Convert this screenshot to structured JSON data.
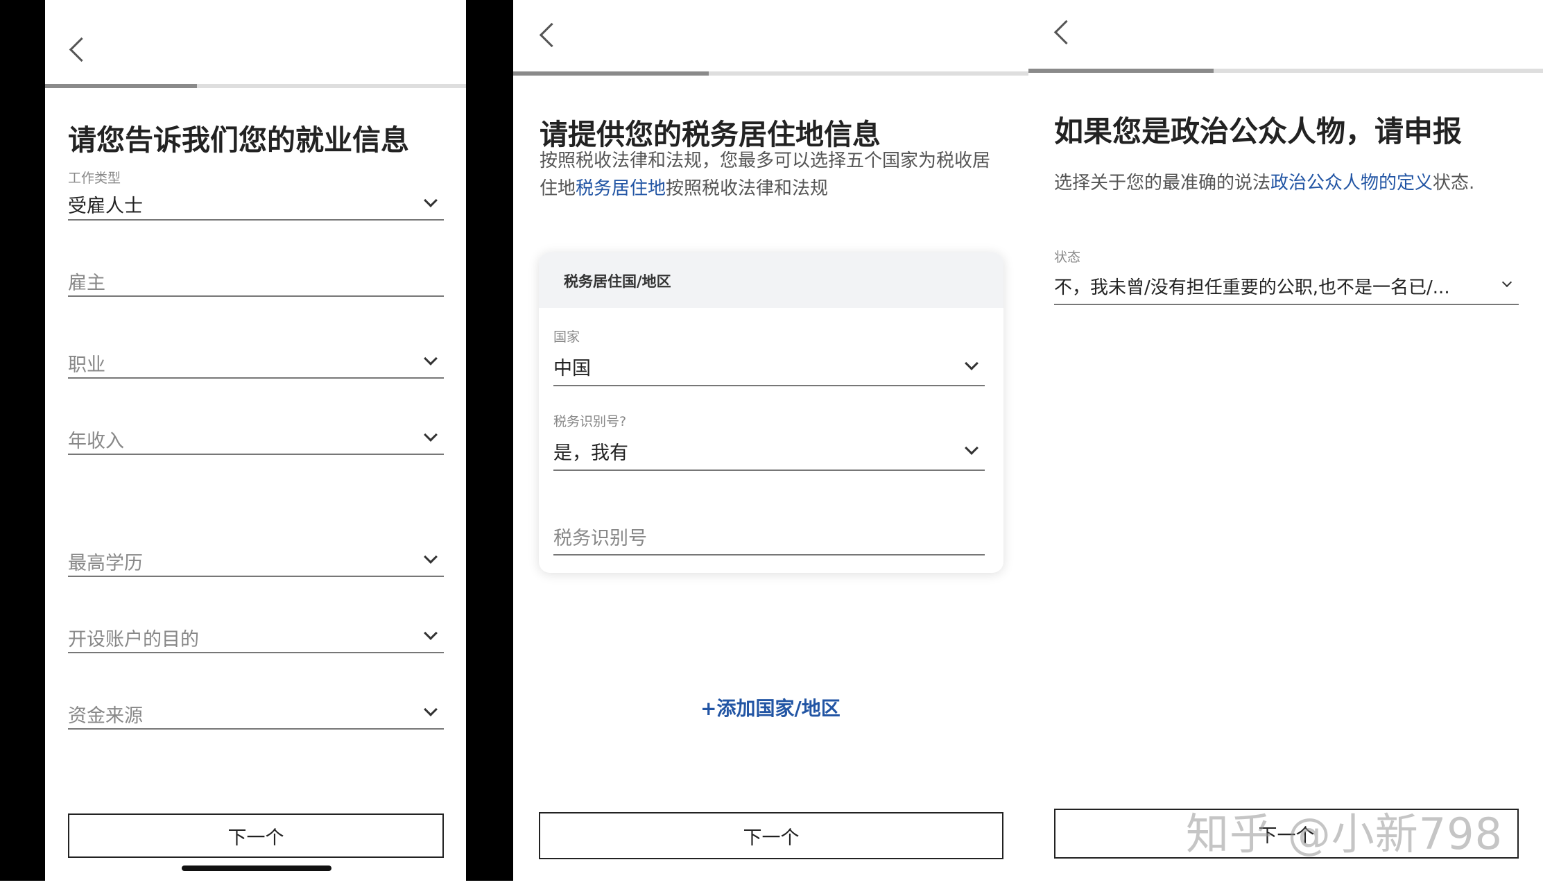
{
  "screen1": {
    "title": "请您告诉我们您的就业信息",
    "fields": [
      {
        "label": "工作类型",
        "value": "受雇人士"
      },
      {
        "placeholder": "雇主"
      },
      {
        "placeholder": "职业"
      },
      {
        "placeholder": "年收入"
      },
      {
        "placeholder": "最高学历"
      },
      {
        "placeholder": "开设账户的目的"
      },
      {
        "placeholder": "资金来源"
      }
    ],
    "next_label": "下一个",
    "progress": 0.36
  },
  "screen2": {
    "title": "请提供您的税务居住地信息",
    "desc_part1": "按照税收法律和法规，您最多可以选择五个国家为税收居住地",
    "desc_link": "税务居住地",
    "desc_part2": "按照税收法律和法规",
    "card_title": "税务居住国/地区",
    "country_label": "国家",
    "country_value": "中国",
    "tin_question_label": "税务识别号?",
    "tin_question_value": "是，我有",
    "tin_placeholder": "税务识别号",
    "add_label": "+添加国家/地区",
    "next_label": "下一个",
    "progress": 0.38
  },
  "screen3": {
    "title": "如果您是政治公众人物，请申报",
    "desc_part1": "选择关于您的最准确的说法",
    "desc_link": "政治公众人物的定义",
    "desc_part2": "状态.",
    "status_label": "状态",
    "status_value": "不，我未曾/没有担任重要的公职,也不是一名已/...",
    "next_label": "下一个",
    "progress": 0.36
  },
  "watermark": "知乎 @小新798",
  "colors": {
    "link": "#2255a4",
    "progress_fill": "#8a8a8a",
    "progress_track": "#dedede"
  }
}
